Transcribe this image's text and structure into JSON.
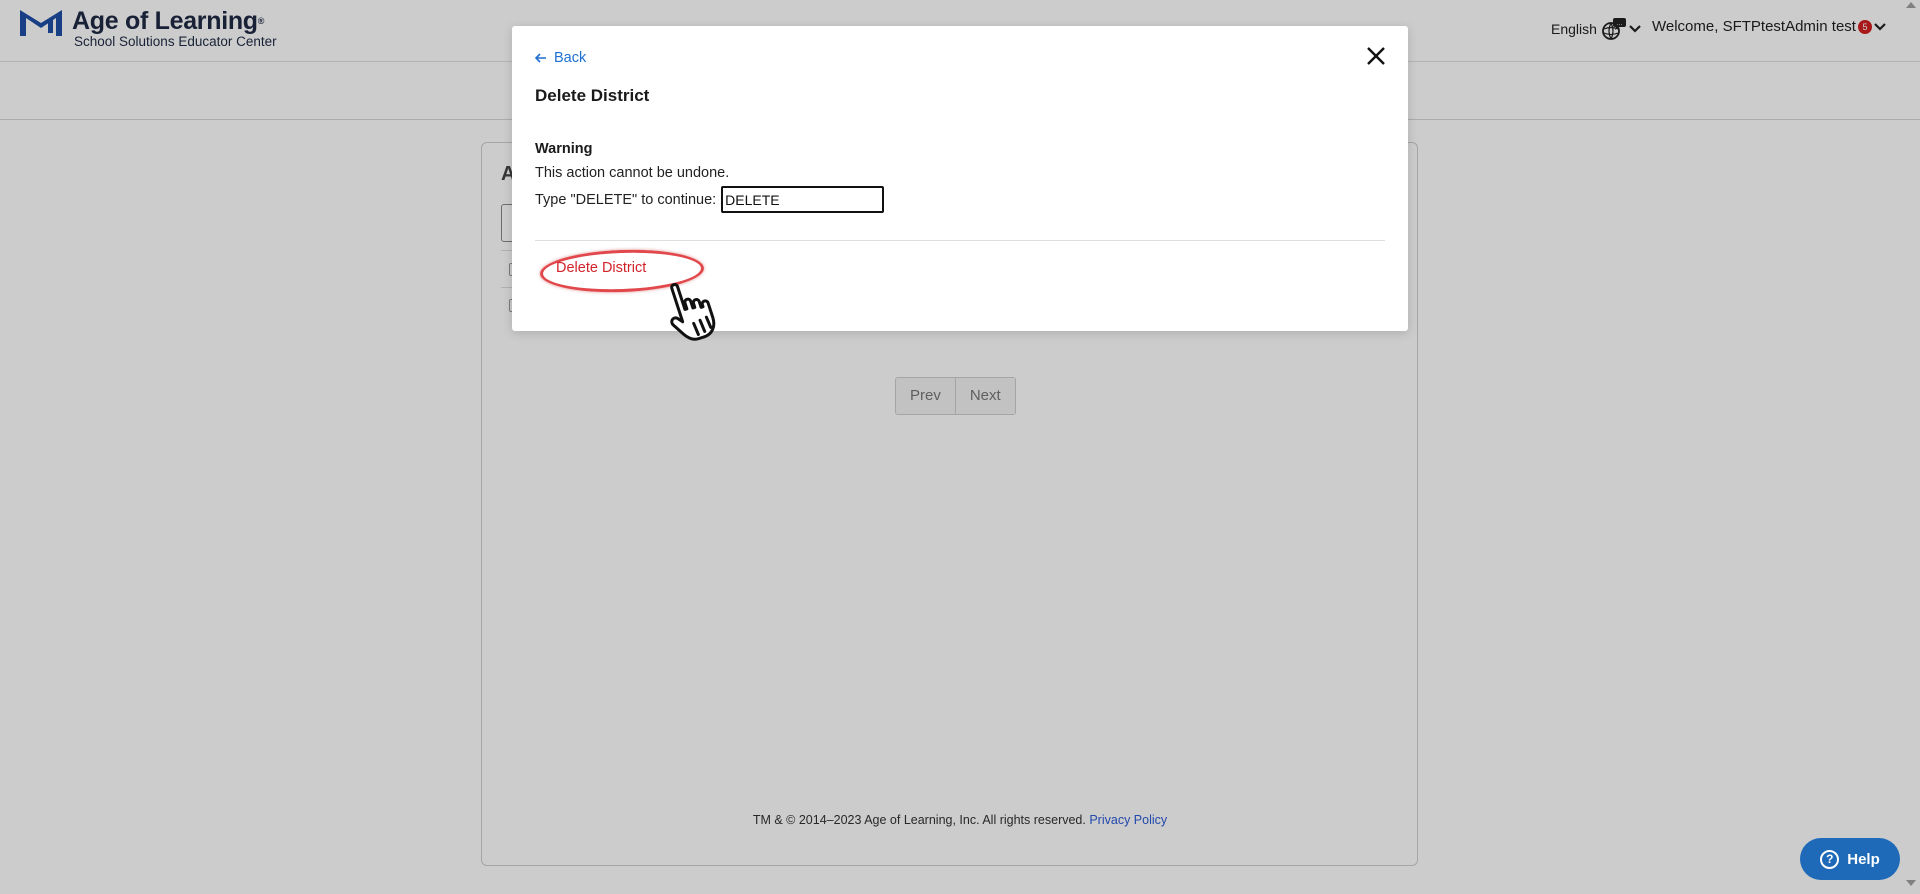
{
  "header": {
    "brand_title": "Age of Learning",
    "brand_sup": "®",
    "brand_subtitle": "School Solutions Educator Center",
    "language": "English",
    "welcome": "Welcome, SFTPtestAdmin test",
    "notification_count": "5"
  },
  "card": {
    "title_initial": "A"
  },
  "pagination": {
    "prev": "Prev",
    "next": "Next"
  },
  "footer": {
    "copyright": "TM & © 2014–2023 Age of Learning, Inc. All rights reserved.",
    "privacy": "Privacy Policy"
  },
  "help": {
    "label": "Help",
    "icon_glyph": "?"
  },
  "modal": {
    "back": "Back",
    "title": "Delete District",
    "warning_title": "Warning",
    "warning_text": "This action cannot be undone.",
    "confirm_prompt": "Type \"DELETE\" to continue:",
    "confirm_value": "DELETE",
    "delete_button": "Delete District"
  },
  "colors": {
    "link": "#1f6fd1",
    "danger": "#d2232a",
    "help_bg": "#1e6ab8",
    "brand": "#1f2a44"
  },
  "icons": {
    "logo": "age-of-learning-logo-icon",
    "language": "globe-chat-icon",
    "dropdown": "chevron-down-icon",
    "back": "arrow-left-icon",
    "close": "close-icon",
    "help": "question-circle-icon",
    "cursor": "hand-pointer-icon"
  }
}
